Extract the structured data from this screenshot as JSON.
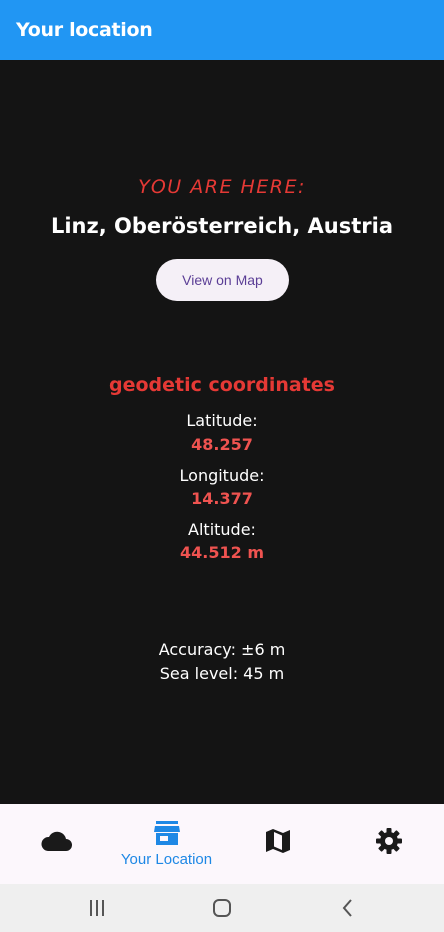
{
  "app_bar": {
    "title": "Your location"
  },
  "location": {
    "here_label": "YOU ARE HERE:",
    "place_name": "Linz, Oberösterreich, Austria",
    "map_button_label": "View on Map"
  },
  "geodetic": {
    "title": "geodetic coordinates",
    "latitude_label": "Latitude:",
    "latitude_value": "48.257",
    "longitude_label": "Longitude:",
    "longitude_value": "14.377",
    "altitude_label": "Altitude:",
    "altitude_value": "44.512 m"
  },
  "extra": {
    "accuracy": "Accuracy: ±6 m",
    "sea_level": "Sea level: 45 m"
  },
  "bottom_nav": {
    "items": [
      {
        "icon": "cloud-icon",
        "label": "",
        "active": false
      },
      {
        "icon": "store-icon",
        "label": "Your Location",
        "active": true
      },
      {
        "icon": "map-icon",
        "label": "",
        "active": false
      },
      {
        "icon": "gear-icon",
        "label": "",
        "active": false
      }
    ]
  },
  "colors": {
    "app_bar": "#2196F3",
    "background": "#141414",
    "accent_red": "#E53935",
    "nav_active": "#1E88E5",
    "button_text": "#5B3E96"
  },
  "system_nav": {
    "buttons": [
      "recent-apps-icon",
      "home-icon",
      "back-icon"
    ]
  }
}
